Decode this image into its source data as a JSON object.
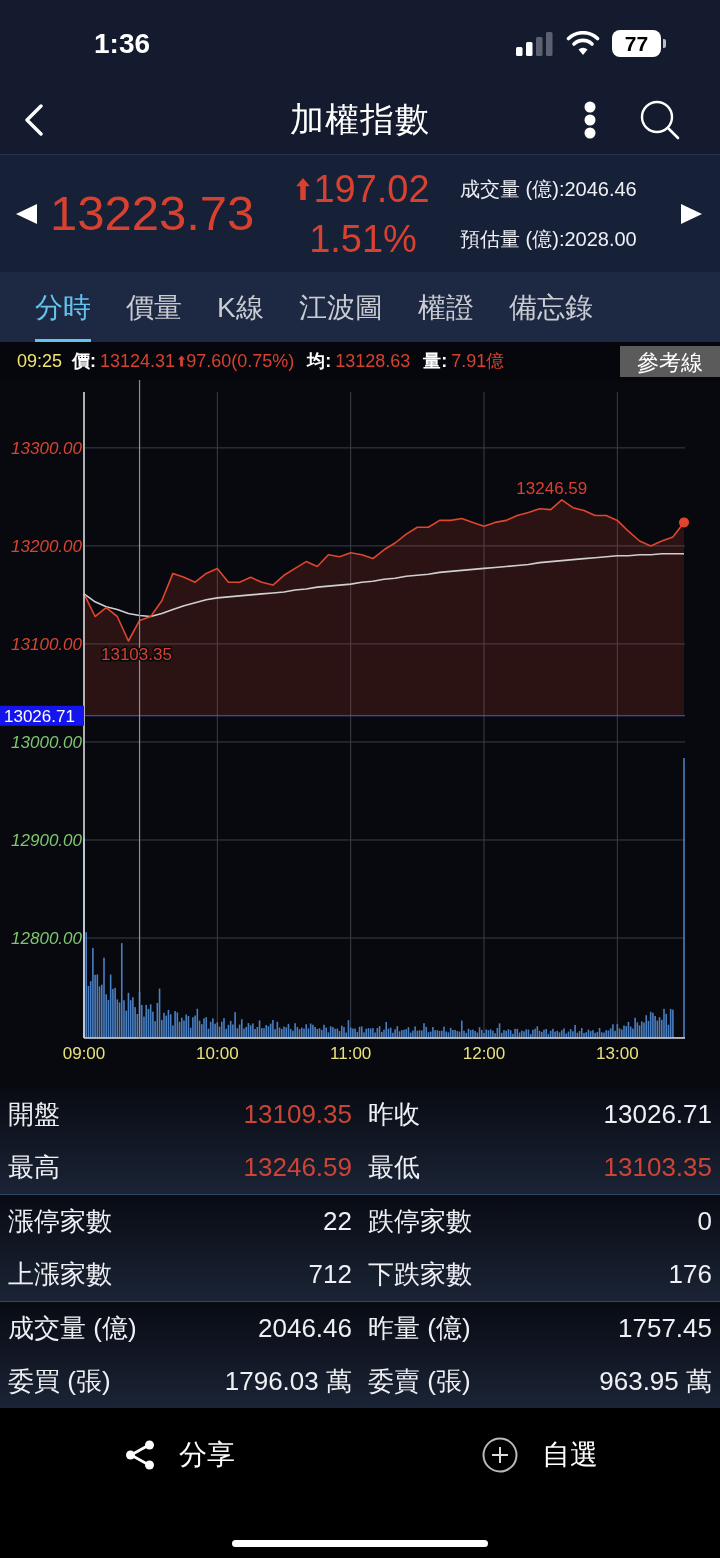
{
  "status_bar": {
    "time": "1:36",
    "battery": "77"
  },
  "nav": {
    "title": "加權指數"
  },
  "quote": {
    "up": true,
    "price": "13223.73",
    "change": "197.02",
    "change_pct": "1.51%",
    "stats": [
      "成交量 (億):2046.46",
      "預估量 (億):2028.00"
    ]
  },
  "tabs": [
    {
      "label": "分時",
      "selected": true
    },
    {
      "label": "價量",
      "selected": false
    },
    {
      "label": "K線",
      "selected": false
    },
    {
      "label": "江波圖",
      "selected": false
    },
    {
      "label": "權證",
      "selected": false
    },
    {
      "label": "備忘錄",
      "selected": false
    }
  ],
  "cursor_info": {
    "time": "09:25",
    "items": [
      {
        "label": "價:",
        "value": "13124.31",
        "up": true,
        "change": "97.60(0.75%)"
      },
      {
        "label": "均:",
        "value": "13128.63"
      },
      {
        "label": "量:",
        "value": "7.91億"
      }
    ],
    "button": "參考線"
  },
  "chart": {
    "chart_data": {
      "type": "area",
      "grid": true,
      "categories": [
        "09:00",
        null,
        null,
        null,
        null,
        null,
        null,
        null,
        null,
        null,
        null,
        null,
        "10:00",
        null,
        null,
        null,
        null,
        null,
        null,
        null,
        null,
        null,
        null,
        null,
        "11:00",
        null,
        null,
        null,
        null,
        null,
        null,
        null,
        null,
        null,
        null,
        null,
        "12:00",
        null,
        null,
        null,
        null,
        null,
        null,
        null,
        null,
        null,
        null,
        null,
        "13:00",
        null,
        null,
        null,
        null,
        null,
        null
      ],
      "series": [
        {
          "type": "area",
          "color": "#e0452f",
          "values": [
            13151,
            13128,
            13137,
            13128,
            13103,
            13124,
            13128,
            13144,
            13172,
            13168,
            13163,
            13172,
            13177,
            13163,
            13163,
            13168,
            13163,
            13160,
            13170,
            13177,
            13184,
            13179,
            13191,
            13189,
            13193,
            13191,
            13187,
            13196,
            13203,
            13212,
            13219,
            13219,
            13226,
            13226,
            13228,
            13224,
            13220,
            13224,
            13226,
            13231,
            13234,
            13238,
            13237,
            13247,
            13239,
            13236,
            13231,
            13231,
            13226,
            13215,
            13205,
            13200,
            13205,
            13209,
            13224
          ]
        },
        {
          "type": "line",
          "color": "#cfcfcf",
          "values": [
            13151,
            13143,
            13138,
            13135,
            13131,
            13129,
            13128,
            13131,
            13135,
            13139,
            13142,
            13145,
            13147,
            13148,
            13149,
            13150,
            13151,
            13152,
            13153,
            13155,
            13156,
            13158,
            13159,
            13160,
            13161,
            13163,
            13164,
            13166,
            13167,
            13169,
            13170,
            13171,
            13173,
            13174,
            13175,
            13176,
            13177,
            13178,
            13179,
            13180,
            13181,
            13183,
            13184,
            13185,
            13186,
            13187,
            13188,
            13189,
            13190,
            13190,
            13191,
            13191,
            13192,
            13192,
            13192
          ]
        }
      ],
      "ylim": [
        12698,
        13357
      ],
      "yticks": [
        {
          "value": 12800,
          "label": "12800.00"
        },
        {
          "value": 12900,
          "label": "12900.00"
        },
        {
          "value": 13000,
          "label": "13000.00"
        },
        {
          "value": 13100,
          "label": "13100.00"
        },
        {
          "value": 13200,
          "label": "13200.00"
        },
        {
          "value": 13300,
          "label": "13300.00"
        }
      ],
      "ref_lines": [
        {
          "axis": "y",
          "value": 13026.71,
          "label": "13026.71"
        }
      ],
      "annotations": [
        "13103.35",
        "13246.59"
      ]
    }
  },
  "stats": [
    [
      [
        {
          "label": "開盤",
          "value": "13109.35",
          "up": true
        },
        {
          "label": "昨收",
          "value": "13026.71",
          "up": false
        }
      ],
      [
        {
          "label": "最高",
          "value": "13246.59",
          "up": true
        },
        {
          "label": "最低",
          "value": "13103.35",
          "up": true
        }
      ]
    ],
    [
      [
        {
          "label": "漲停家數",
          "value": "22",
          "up": false
        },
        {
          "label": "跌停家數",
          "value": "0",
          "up": false
        }
      ],
      [
        {
          "label": "上漲家數",
          "value": "712",
          "up": false
        },
        {
          "label": "下跌家數",
          "value": "176",
          "up": false
        }
      ]
    ],
    [
      [
        {
          "label": "成交量 (億)",
          "value": "2046.46",
          "up": false
        },
        {
          "label": "昨量 (億)",
          "value": "1757.45",
          "up": false
        }
      ],
      [
        {
          "label": "委買 (張)",
          "value": "1796.03 萬",
          "up": false
        },
        {
          "label": "委賣 (張)",
          "value": "963.95 萬",
          "up": false
        }
      ]
    ]
  ],
  "actions": [
    {
      "kind": "share",
      "label": "分享"
    },
    {
      "kind": "add",
      "label": "自選"
    }
  ]
}
